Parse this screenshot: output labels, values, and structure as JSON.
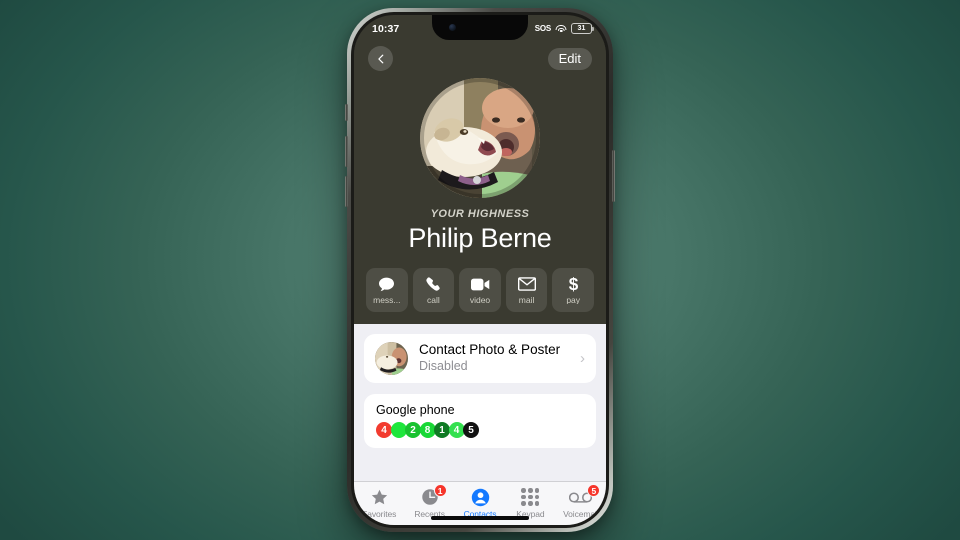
{
  "background": {
    "color_center": "#5d8d7f",
    "color_edge": "#1f4a41"
  },
  "statusbar": {
    "time": "10:37",
    "sos_label": "SOS",
    "wifi_icon": "wifi-icon",
    "battery_level": "31"
  },
  "nav": {
    "back_icon": "chevron-left-icon",
    "edit_label": "Edit"
  },
  "contact": {
    "avatar_name": "contact-avatar-photo",
    "nickname": "YOUR HIGHNESS",
    "full_name": "Philip Berne"
  },
  "actions": [
    {
      "label": "mess...",
      "icon": "message-bubble-icon"
    },
    {
      "label": "call",
      "icon": "phone-handset-icon"
    },
    {
      "label": "video",
      "icon": "video-camera-icon"
    },
    {
      "label": "mail",
      "icon": "envelope-icon"
    },
    {
      "label": "pay",
      "icon": "dollar-sign-icon"
    }
  ],
  "poster": {
    "title": "Contact Photo & Poster",
    "subtitle": "Disabled",
    "chevron": "›",
    "thumb_name": "poster-thumbnail-photo"
  },
  "phone_section": {
    "label": "Google phone",
    "digits": [
      {
        "value": "4",
        "color": "#f23b2f"
      },
      {
        "value": "",
        "color": "#1ee63c"
      },
      {
        "value": "2",
        "color": "#18c22f"
      },
      {
        "value": "8",
        "color": "#18d836"
      },
      {
        "value": "1",
        "color": "#0f7a24"
      },
      {
        "value": "4",
        "color": "#34e04f"
      },
      {
        "value": "5",
        "color": "#121212"
      }
    ]
  },
  "tabs": [
    {
      "label": "Favorites",
      "icon": "star-icon",
      "badge": "",
      "selected": false
    },
    {
      "label": "Recents",
      "icon": "clock-icon",
      "badge": "1",
      "selected": false
    },
    {
      "label": "Contacts",
      "icon": "person-icon",
      "badge": "",
      "selected": true
    },
    {
      "label": "Keypad",
      "icon": "keypad-icon",
      "badge": "",
      "selected": false
    },
    {
      "label": "Voicemail",
      "icon": "voicemail-icon",
      "badge": "5",
      "selected": false
    }
  ],
  "accent_color": "#1479ff",
  "badge_color": "#f6352b"
}
